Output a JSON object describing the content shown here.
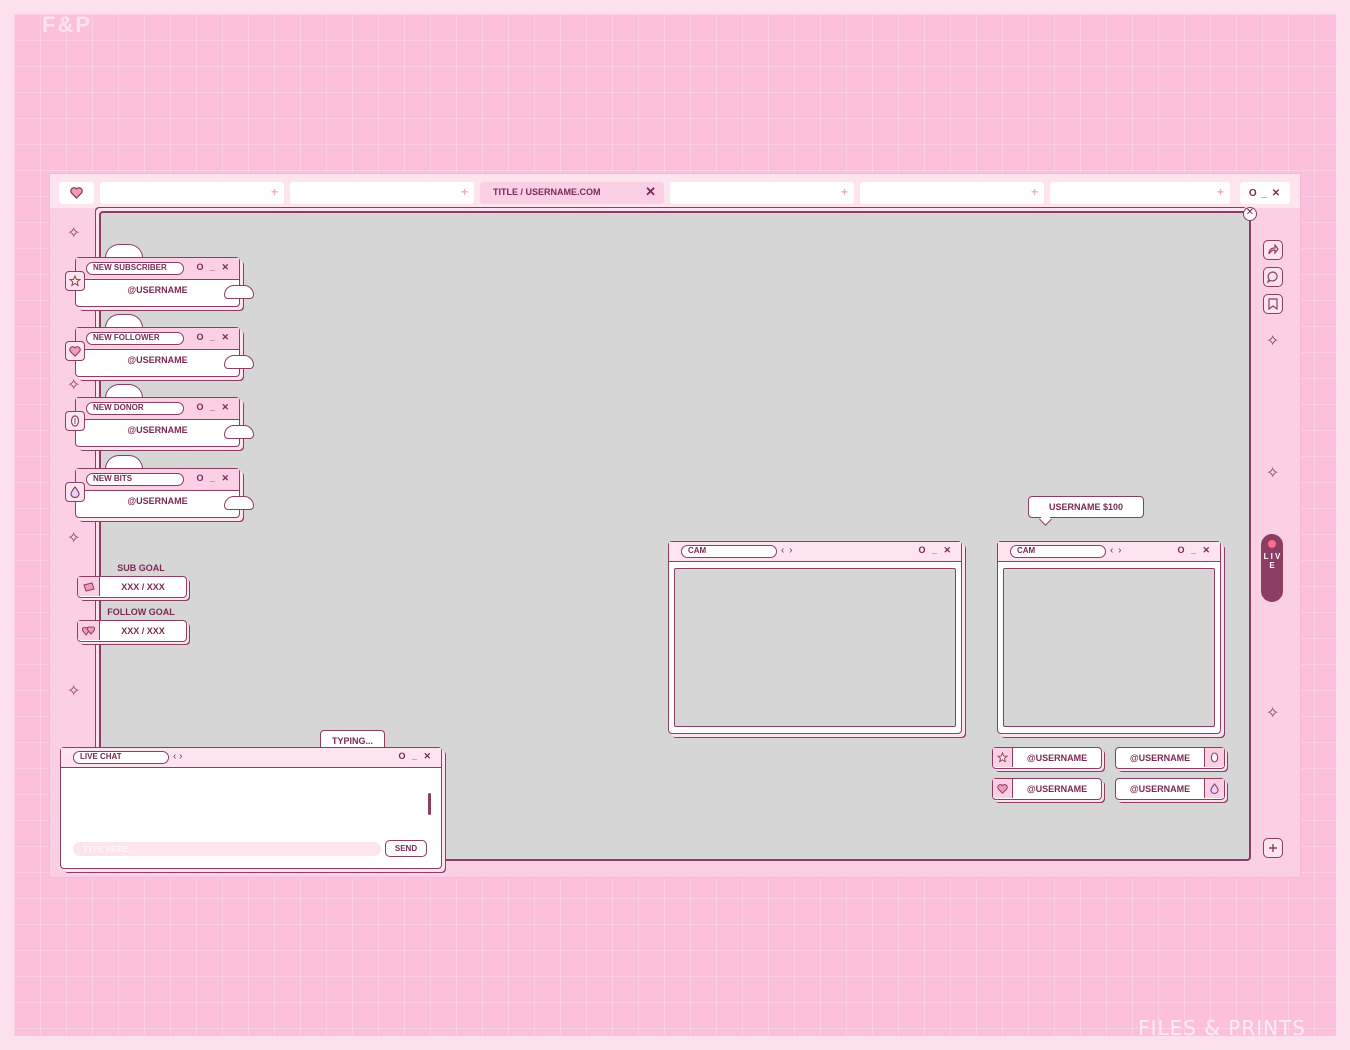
{
  "branding": {
    "top_left": "F&P",
    "bottom_right": "FILES & PRINTS"
  },
  "tabs": {
    "active_title": "TITLE / USERNAME.COM",
    "close": "✕",
    "plus": "+",
    "window_controls": "O _ ✕"
  },
  "screen": {
    "close": "✕"
  },
  "alerts": [
    {
      "title": "NEW SUBSCRIBER",
      "user": "@USERNAME",
      "icon": "star-icon"
    },
    {
      "title": "NEW FOLLOWER",
      "user": "@USERNAME",
      "icon": "heart-icon"
    },
    {
      "title": "NEW DONOR",
      "user": "@USERNAME",
      "icon": "coin-icon"
    },
    {
      "title": "NEW BITS",
      "user": "@USERNAME",
      "icon": "drop-icon"
    }
  ],
  "alert_controls": "O _ ✕",
  "goals": [
    {
      "label": "SUB GOAL",
      "value": "XXX / XXX"
    },
    {
      "label": "FOLLOW GOAL",
      "value": "XXX / XXX"
    }
  ],
  "cams": [
    {
      "title": "CAM",
      "controls": "O _ ✕",
      "nav": "‹ ›"
    },
    {
      "title": "CAM",
      "controls": "O _ ✕",
      "nav": "‹ ›"
    }
  ],
  "donation_bubble": "USERNAME $100",
  "recent_tags": [
    {
      "user": "@USERNAME",
      "icon": "star-icon"
    },
    {
      "user": "@USERNAME",
      "icon": "coin-icon"
    },
    {
      "user": "@USERNAME",
      "icon": "heart-icon"
    },
    {
      "user": "@USERNAME",
      "icon": "drop-icon"
    }
  ],
  "live_label": "L I V E",
  "chat": {
    "title": "LIVE CHAT",
    "typing": "TYPING...",
    "placeholder": "TYPE HERE...",
    "send": "SEND",
    "controls": "O _ ✕",
    "nav": "‹ ›"
  },
  "colors": {
    "accent": "#8c3d62",
    "pink": "#fcc0dc",
    "screen": "#d6d6d6"
  }
}
